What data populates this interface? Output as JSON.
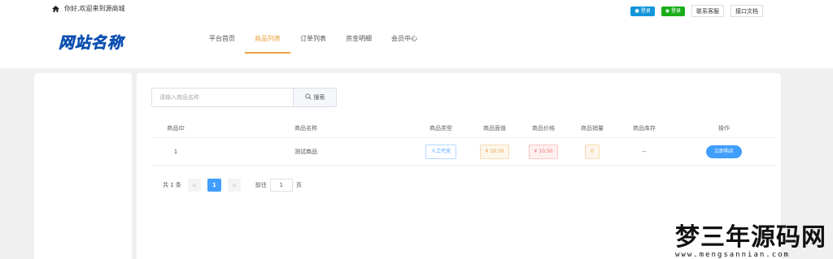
{
  "header": {
    "welcome": "你好,欢迎来到源商城",
    "qq_login": "登录",
    "wx_login": "登录",
    "contact": "联系客服",
    "api_docs": "接口文档"
  },
  "logo": "网站名称",
  "nav": [
    {
      "label": "平台首页"
    },
    {
      "label": "商品列表"
    },
    {
      "label": "订单列表"
    },
    {
      "label": "资金明细"
    },
    {
      "label": "会员中心"
    }
  ],
  "search": {
    "placeholder": "请输入商品名称",
    "button": "搜索"
  },
  "table": {
    "headers": [
      "商品ID",
      "商品名称",
      "商品类型",
      "商品面值",
      "商品价格",
      "商品销量",
      "商品库存",
      "操作"
    ],
    "rows": [
      {
        "id": "1",
        "name": "测试商品",
        "type": "人工代充",
        "face_value": "¥ 10.50",
        "price": "¥ 10.50",
        "sales": "0",
        "stock": "--",
        "action": "立即购买"
      }
    ]
  },
  "pager": {
    "total": "共 1 条",
    "prev": "<",
    "current": "1",
    "next": ">",
    "goto_label": "前往",
    "goto_value": "1",
    "page_unit": "页"
  },
  "watermark": {
    "title": "梦三年源码网",
    "url": "www.mengsannian.com"
  },
  "colors": {
    "accent": "#e9a13b",
    "primary": "#409eff",
    "logo": "#1e6fe0"
  }
}
